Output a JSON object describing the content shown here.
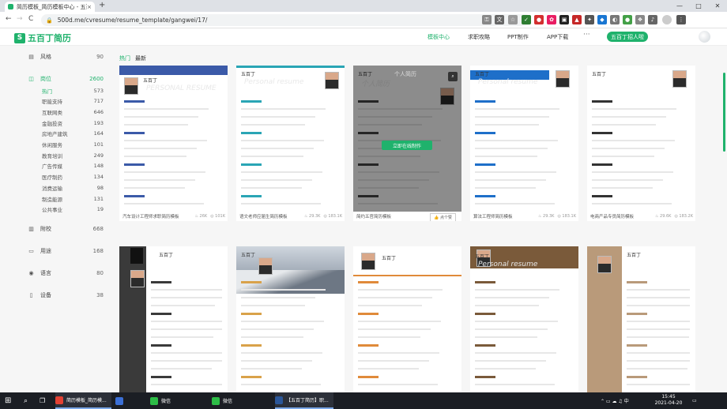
{
  "browser": {
    "tab_title": "简历模板_简历模板中心 - 五百丁",
    "tab_close": "×",
    "new_tab": "+",
    "url": "500d.me/cvresume/resume_template/gangwei/17/",
    "back": "←",
    "forward": "→",
    "reload": "C",
    "minimize": "—",
    "maximize": "□",
    "close": "✕"
  },
  "site": {
    "logo_text": "五百丁简历",
    "logo_mark": "S",
    "nav": [
      "模板中心",
      "求职攻略",
      "PPT制作",
      "APP下载"
    ],
    "more": "···",
    "hire_button": "五百丁招人啦",
    "subtabs": [
      "热门",
      "最新"
    ]
  },
  "sidebar": {
    "groups": [
      {
        "icon": "▤",
        "label": "风格",
        "count": "90"
      },
      {
        "icon": "◫",
        "label": "岗位",
        "count": "2600",
        "active": true,
        "children": [
          {
            "label": "热门",
            "count": "573",
            "active": true
          },
          {
            "label": "职能支持",
            "count": "717"
          },
          {
            "label": "互联网类",
            "count": "646"
          },
          {
            "label": "金融投资",
            "count": "193"
          },
          {
            "label": "房地产建筑",
            "count": "164"
          },
          {
            "label": "休闲服务",
            "count": "101"
          },
          {
            "label": "教育培训",
            "count": "249"
          },
          {
            "label": "广告传媒",
            "count": "148"
          },
          {
            "label": "医疗制药",
            "count": "134"
          },
          {
            "label": "消费运输",
            "count": "98"
          },
          {
            "label": "制造能源",
            "count": "131"
          },
          {
            "label": "公共事业",
            "count": "19"
          }
        ]
      },
      {
        "icon": "▥",
        "label": "附校",
        "count": "668"
      },
      {
        "icon": "▭",
        "label": "用途",
        "count": "168"
      },
      {
        "icon": "◉",
        "label": "语言",
        "count": "80"
      },
      {
        "icon": "▯",
        "label": "设备",
        "count": "38"
      }
    ]
  },
  "cards": [
    {
      "name": "汽车设计工程师求职简历模板",
      "hot": "26K",
      "views": "101K",
      "style": "blue-sidebar",
      "accent": "#3b5aa8",
      "ghost": "PERSONAL RESUME"
    },
    {
      "name": "语文老师应届生简历模板",
      "hot": "29.3K",
      "views": "183.1K",
      "style": "teal",
      "accent": "#2aa5b5",
      "ghost": "Personal resume"
    },
    {
      "name": "简约五官简历模板",
      "hot": "",
      "views": "",
      "style": "hover",
      "accent": "#444444",
      "ghost": "个人简历",
      "use_button": "立即在线制作",
      "like": "点个赞",
      "search": "⌕"
    },
    {
      "name": "算法工程师简历模板",
      "hot": "29.3K",
      "views": "183.1K",
      "style": "bluebar",
      "accent": "#1e6fc9",
      "ghost": "Personal resume"
    },
    {
      "name": "电商产品专员简历模板",
      "hot": "29.6K",
      "views": "183.2K",
      "style": "plain",
      "accent": "#333333",
      "ghost": ""
    },
    {
      "name": "",
      "style": "dark-left",
      "accent": "#3a3a3a",
      "ghost": ""
    },
    {
      "name": "",
      "style": "mountain",
      "accent": "#d9a24a",
      "ghost": ""
    },
    {
      "name": "",
      "style": "orange-line",
      "accent": "#e08a3a",
      "ghost": ""
    },
    {
      "name": "",
      "style": "brown-top",
      "accent": "#7a5a3a",
      "ghost": "Personal resume"
    },
    {
      "name": "",
      "style": "tan-left",
      "accent": "#b99a7a",
      "ghost": ""
    }
  ],
  "resume_name": "五百丁",
  "card_stats_icons": {
    "hot": "♨",
    "views": "◎",
    "like": "👍"
  },
  "taskbar": {
    "items": [
      {
        "label": "简历模板_简历模...",
        "icon": "chrome",
        "color": "#e34133",
        "open": true
      },
      {
        "label": "",
        "icon": "check",
        "color": "#3b6fd6"
      },
      {
        "label": "微信",
        "icon": "wechat",
        "color": "#2dbd47",
        "open": false
      },
      {
        "label": "微信",
        "icon": "wechat",
        "color": "#2dbd47",
        "open": false
      },
      {
        "label": "【五百丁简历】职...",
        "icon": "word",
        "color": "#2b579a",
        "open": true
      }
    ],
    "time": "15:45",
    "date": "2021-04-20"
  }
}
